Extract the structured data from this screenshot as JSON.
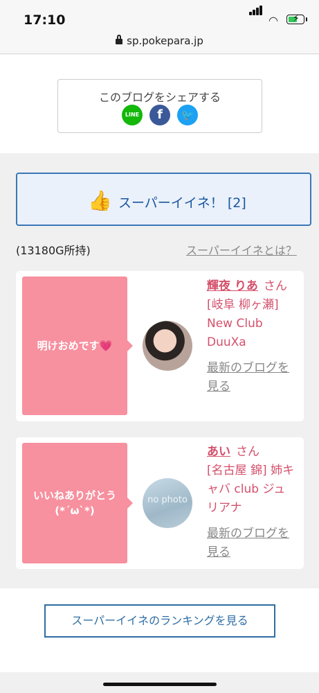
{
  "status": {
    "time": "17:10"
  },
  "browser": {
    "url": "sp.pokepara.jp"
  },
  "share": {
    "title": "このブログをシェアする",
    "line_label": "LINE",
    "facebook_label": "f",
    "twitter_label": "🐦"
  },
  "super_iine": {
    "label": "スーパーイイネ！ [2]"
  },
  "points_text": "(13180G所持)",
  "what_link": "スーパーイイネとは？",
  "entries": [
    {
      "message": "明けおめです💗",
      "name": "輝夜 りあ",
      "san": "さん",
      "shop": "[岐阜 柳ヶ瀬] New Club DuuXa",
      "blog_link": "最新のブログを見る"
    },
    {
      "message": "いいねありがとう\n(*´ω`*)",
      "name": "あい",
      "san": "さん",
      "shop": "[名古屋 錦] 姉キャバ club ジュリアナ",
      "blog_link": "最新のブログを見る",
      "avatar_text": "no photo"
    }
  ],
  "ranking_button": "スーパーイイネのランキングを見る",
  "colors": {
    "accent": "#3a77b7",
    "pink": "#f7909f",
    "name": "#d4506b"
  }
}
